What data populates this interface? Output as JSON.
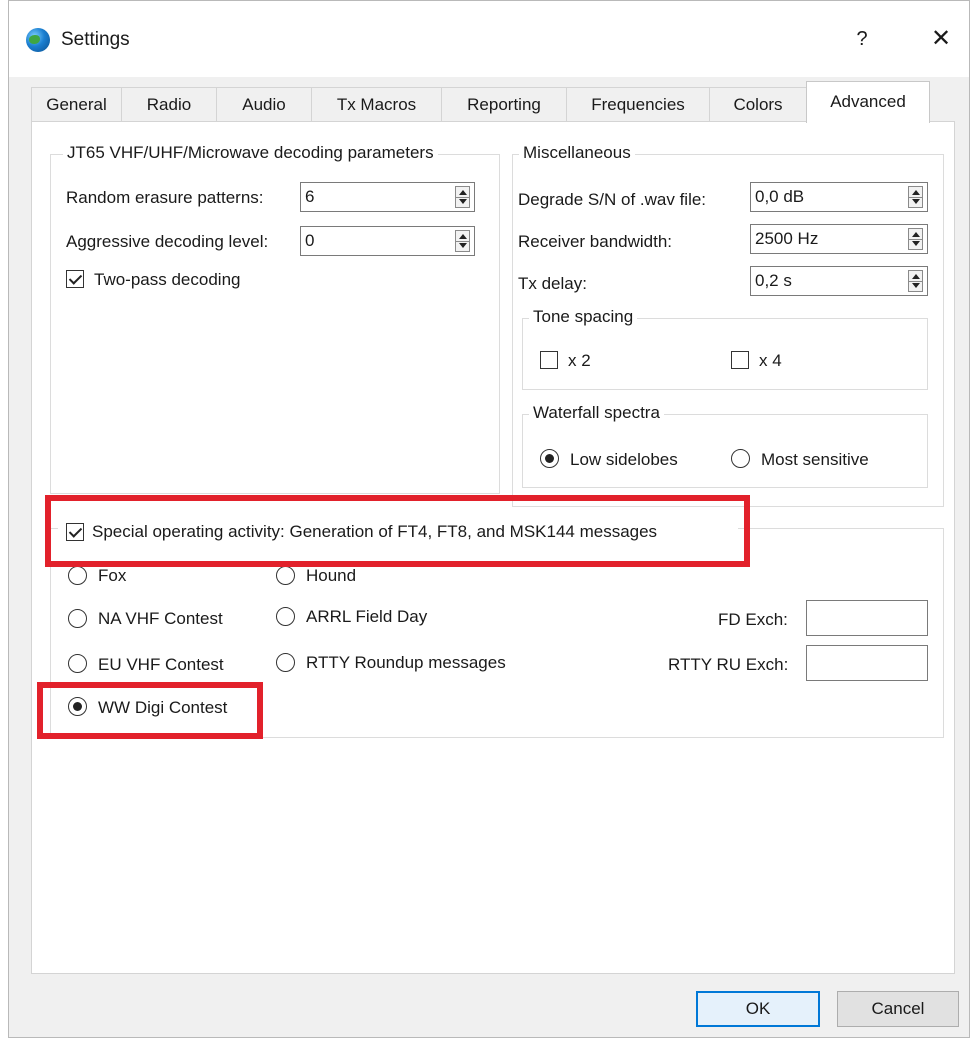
{
  "window": {
    "title": "Settings",
    "help_label": "?",
    "close_label": "✕"
  },
  "tabs": [
    {
      "label": "General"
    },
    {
      "label": "Radio"
    },
    {
      "label": "Audio"
    },
    {
      "label": "Tx Macros"
    },
    {
      "label": "Reporting"
    },
    {
      "label": "Frequencies"
    },
    {
      "label": "Colors"
    },
    {
      "label": "Advanced",
      "active": true
    }
  ],
  "jt65": {
    "title": "JT65 VHF/UHF/Microwave decoding parameters",
    "random_erasure_label": "Random erasure patterns:",
    "random_erasure_value": "6",
    "aggressive_label": "Aggressive decoding level:",
    "aggressive_value": "0",
    "two_pass_label": "Two-pass decoding",
    "two_pass_checked": true
  },
  "misc": {
    "title": "Miscellaneous",
    "degrade_label": "Degrade S/N of .wav file:",
    "degrade_value": "0,0 dB",
    "bandwidth_label": "Receiver bandwidth:",
    "bandwidth_value": "2500  Hz",
    "txdelay_label": "Tx delay:",
    "txdelay_value": "0,2  s",
    "tone_spacing": {
      "title": "Tone spacing",
      "x2_label": "x 2",
      "x4_label": "x 4"
    },
    "waterfall": {
      "title": "Waterfall spectra",
      "low_label": "Low sidelobes",
      "most_label": "Most sensitive",
      "selected": "low"
    }
  },
  "special": {
    "checkbox_label": "Special operating activity:  Generation of FT4, FT8, and MSK144 messages",
    "checked": true,
    "options": {
      "fox": "Fox",
      "hound": "Hound",
      "na_vhf": "NA VHF Contest",
      "arrl": "ARRL Field Day",
      "eu_vhf": "EU VHF Contest",
      "rtty": "RTTY Roundup messages",
      "ww_digi": "WW Digi Contest"
    },
    "selected": "ww_digi",
    "fd_exch_label": "FD Exch:",
    "fd_exch_value": "",
    "rtty_exch_label": "RTTY RU Exch:",
    "rtty_exch_value": ""
  },
  "buttons": {
    "ok": "OK",
    "cancel": "Cancel"
  },
  "colors": {
    "highlight": "#e2212b",
    "accent": "#0078d7"
  }
}
